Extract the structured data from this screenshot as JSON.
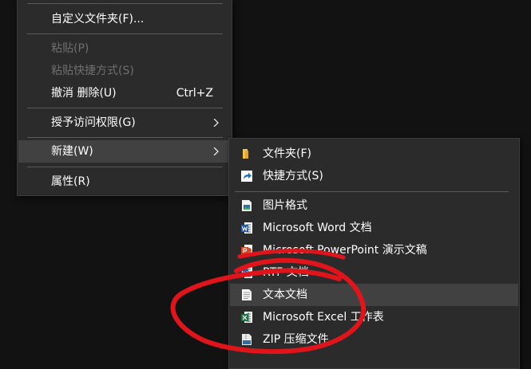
{
  "main_menu": {
    "customize_folder": "自定义文件夹(F)...",
    "paste": "粘贴(P)",
    "paste_shortcut": "粘贴快捷方式(S)",
    "undo_delete": "撤消 删除(U)",
    "undo_shortcut": "Ctrl+Z",
    "grant_access": "授予访问权限(G)",
    "new": "新建(W)",
    "properties": "属性(R)"
  },
  "new_submenu": {
    "items": [
      {
        "label": "文件夹(F)",
        "icon": "folder-icon"
      },
      {
        "label": "快捷方式(S)",
        "icon": "shortcut-icon"
      },
      {
        "label": "图片格式",
        "icon": "image-file-icon"
      },
      {
        "label": "Microsoft Word 文档",
        "icon": "word-icon"
      },
      {
        "label": "Microsoft PowerPoint 演示文稿",
        "icon": "powerpoint-icon"
      },
      {
        "label": "RTF 文档",
        "icon": "rtf-icon"
      },
      {
        "label": "文本文档",
        "icon": "text-document-icon"
      },
      {
        "label": "Microsoft Excel 工作表",
        "icon": "excel-icon"
      },
      {
        "label": "ZIP 压缩文件",
        "icon": "zip-icon"
      }
    ],
    "highlighted_item": "文本文档"
  },
  "colors": {
    "background": "#121212",
    "menu_background": "#2b2b2b",
    "hover_background": "#414141",
    "disabled_text": "#6f6f6f",
    "annotation_red": "#e0151b"
  }
}
